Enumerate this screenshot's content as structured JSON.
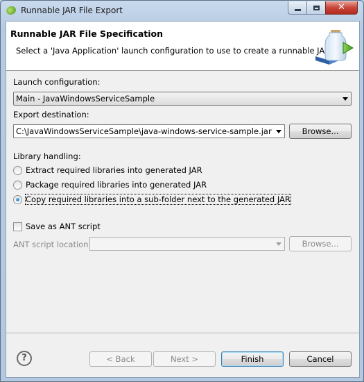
{
  "window": {
    "title": "Runnable JAR File Export",
    "controls": {
      "minimize": "minimize",
      "maximize": "maximize",
      "close": "✕"
    }
  },
  "header": {
    "title": "Runnable JAR File Specification",
    "description": "Select a 'Java Application' launch configuration to use to create a runnable JAR."
  },
  "launch": {
    "label": "Launch configuration:",
    "value": "Main - JavaWindowsServiceSample"
  },
  "export": {
    "label": "Export destination:",
    "value": "C:\\JavaWindowsServiceSample\\java-windows-service-sample.jar",
    "browse_label": "Browse..."
  },
  "library": {
    "label": "Library handling:",
    "options": [
      {
        "label": "Extract required libraries into generated JAR",
        "checked": false
      },
      {
        "label": "Package required libraries into generated JAR",
        "checked": false
      },
      {
        "label": "Copy required libraries into a sub-folder next to the generated JAR",
        "checked": true
      }
    ]
  },
  "ant": {
    "checkbox_label": "Save as ANT script",
    "checked": false,
    "location_label": "ANT script location:",
    "location_value": "",
    "browse_label": "Browse..."
  },
  "footer": {
    "help": "?",
    "back_label": "< Back",
    "next_label": "Next >",
    "finish_label": "Finish",
    "cancel_label": "Cancel"
  }
}
